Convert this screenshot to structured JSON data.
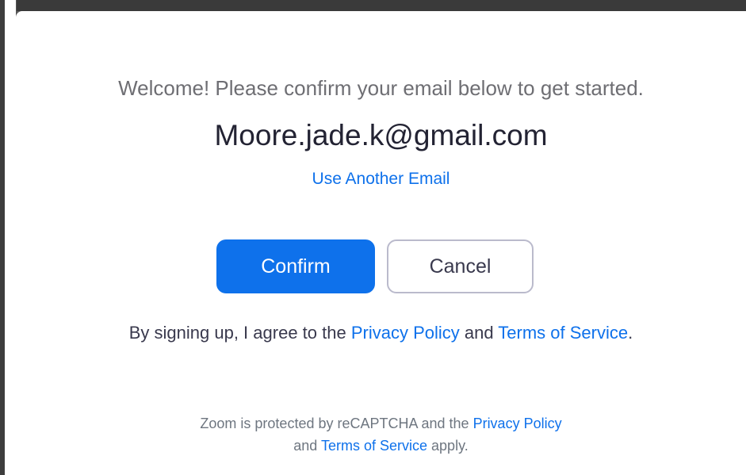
{
  "dialog": {
    "welcome_text": "Welcome! Please confirm your email below to get started.",
    "email": "Moore.jade.k@gmail.com",
    "use_another_email": "Use Another Email",
    "confirm_label": "Confirm",
    "cancel_label": "Cancel",
    "agreement": {
      "prefix": "By signing up, I agree to the ",
      "privacy_policy": "Privacy Policy",
      "and": " and ",
      "terms_of_service": "Terms of Service",
      "suffix": "."
    },
    "recaptcha": {
      "line1_prefix": "Zoom is protected by reCAPTCHA and the ",
      "privacy_policy": "Privacy Policy",
      "line2_prefix": "and ",
      "terms_of_service": "Terms of Service",
      "line2_suffix": " apply."
    }
  },
  "colors": {
    "accent": "#0e71eb",
    "primary_text": "#232333",
    "secondary_text": "#6e6e73",
    "cancel_border": "#babacc"
  }
}
